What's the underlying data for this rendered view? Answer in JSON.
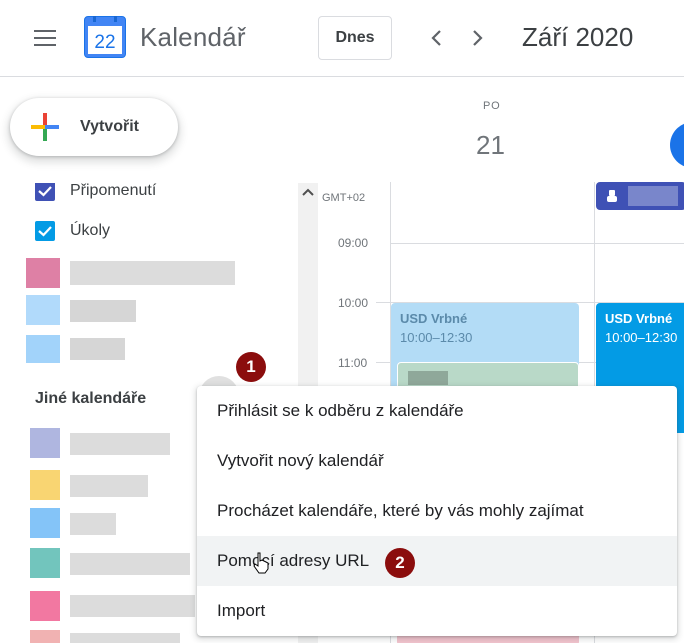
{
  "header": {
    "app_title": "Kalendář",
    "logo_day": "22",
    "today_button": "Dnes",
    "period_title": "Září 2020",
    "icons": [
      "menu-icon",
      "calendar-logo-icon",
      "chevron-left-icon",
      "chevron-right-icon"
    ]
  },
  "create_button": {
    "label": "Vytvořit",
    "icon": "multicolor-plus-icon"
  },
  "sidebar": {
    "my_calendars": [
      {
        "label": "Připomenutí",
        "checked": true,
        "color": "#3f51b5"
      },
      {
        "label": "Úkoly",
        "checked": true,
        "color": "#039be5"
      }
    ],
    "other_calendars_title": "Jiné kalendáře"
  },
  "grid": {
    "day_of_week": "PO",
    "day_number": "21",
    "timezone": "GMT+02",
    "hours": [
      "09:00",
      "10:00",
      "11:00"
    ],
    "events": [
      {
        "title": "USD Vrbné",
        "time": "10:00–12:30"
      },
      {
        "title": "USD Vrbné",
        "time": "10:00–12:30"
      }
    ]
  },
  "menu": {
    "items": [
      "Přihlásit se k odběru z kalendáře",
      "Vytvořit nový kalendář",
      "Procházet kalendáře, které by vás mohly zajímat",
      "Pomocí adresy URL",
      "Import"
    ],
    "hovered_index": 3
  },
  "annotations": {
    "badge_1": "1",
    "badge_2": "2"
  },
  "colors": {
    "accent_blue": "#1a73e8",
    "event_light": "#b3dcf6",
    "event_dark": "#039be5",
    "badge": "#8b0d0d",
    "indigo": "#3f51b5"
  }
}
